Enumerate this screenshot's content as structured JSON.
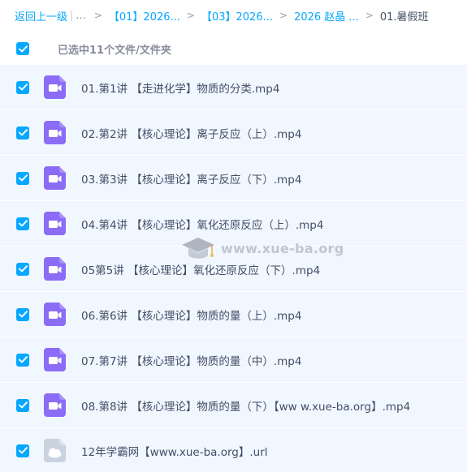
{
  "breadcrumb": {
    "back": "返回上一级",
    "bar": "|",
    "ellipsis": "...",
    "separator": ">",
    "crumbs": [
      "【01】2026...",
      "【03】2026...",
      "2026 赵晶 ..."
    ],
    "current": "01.暑假班"
  },
  "selection": {
    "label": "已选中11个文件/文件夹"
  },
  "files": [
    {
      "name": "01.第1讲 【走进化学】物质的分类.mp4",
      "type": "video",
      "checked": true
    },
    {
      "name": "02.第2讲 【核心理论】离子反应（上）.mp4",
      "type": "video",
      "checked": true
    },
    {
      "name": "03.第3讲 【核心理论】离子反应（下）.mp4",
      "type": "video",
      "checked": true
    },
    {
      "name": "04.第4讲 【核心理论】氧化还原反应（上）.mp4",
      "type": "video",
      "checked": true
    },
    {
      "name": "05第5讲 【核心理论】氧化还原反应（下）.mp4",
      "type": "video",
      "checked": true
    },
    {
      "name": "06.第6讲 【核心理论】物质的量（上）.mp4",
      "type": "video",
      "checked": true
    },
    {
      "name": "07.第7讲 【核心理论】物质的量（中）.mp4",
      "type": "video",
      "checked": true
    },
    {
      "name": "08.第8讲 【核心理论】物质的量（下）【ww w.xue-ba.org】.mp4",
      "type": "video",
      "checked": true
    },
    {
      "name": "12年学霸网【www.xue-ba.org】.url",
      "type": "link",
      "checked": true
    }
  ],
  "watermark": {
    "text": "www.xue-ba.org",
    "icon": "graduation-cap-icon"
  },
  "colors": {
    "accent": "#06a7ff",
    "row_bg": "#f1f7ff",
    "video_icon": "#8b6cf6",
    "link_icon": "#c9d3df"
  },
  "icons": {
    "checkbox": "checkmark-icon",
    "video": "video-file-icon",
    "link": "link-file-icon"
  }
}
